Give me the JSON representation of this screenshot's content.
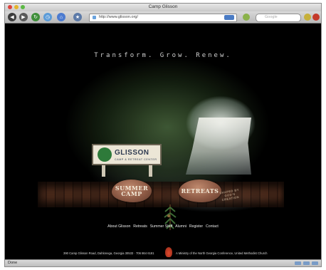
{
  "window": {
    "title": "Camp Glisson"
  },
  "toolbar": {
    "url": "http://www.glisson.org/",
    "search_placeholder": "Google"
  },
  "site": {
    "tagline": "Transform. Grow. Renew.",
    "logo_name": "GLISSON",
    "logo_subtitle": "CAMP & RETREAT CENTER",
    "buttons": {
      "summer_camp": "SUMMER CAMP",
      "retreats": "RETREATS"
    },
    "stamp": "SHAPED BY GOD'S CREATION",
    "nav": [
      "About Glisson",
      "Retreats",
      "Summer Staff",
      "Alumni",
      "Register",
      "Contact"
    ],
    "footer_address": "390 Camp Glisson Road, Dahlonega, Georgia 30533 · 706 864 6181",
    "footer_ministry": "A Ministry of the North Georgia Conference, United Methodist Church"
  },
  "status": {
    "text": "Done"
  }
}
